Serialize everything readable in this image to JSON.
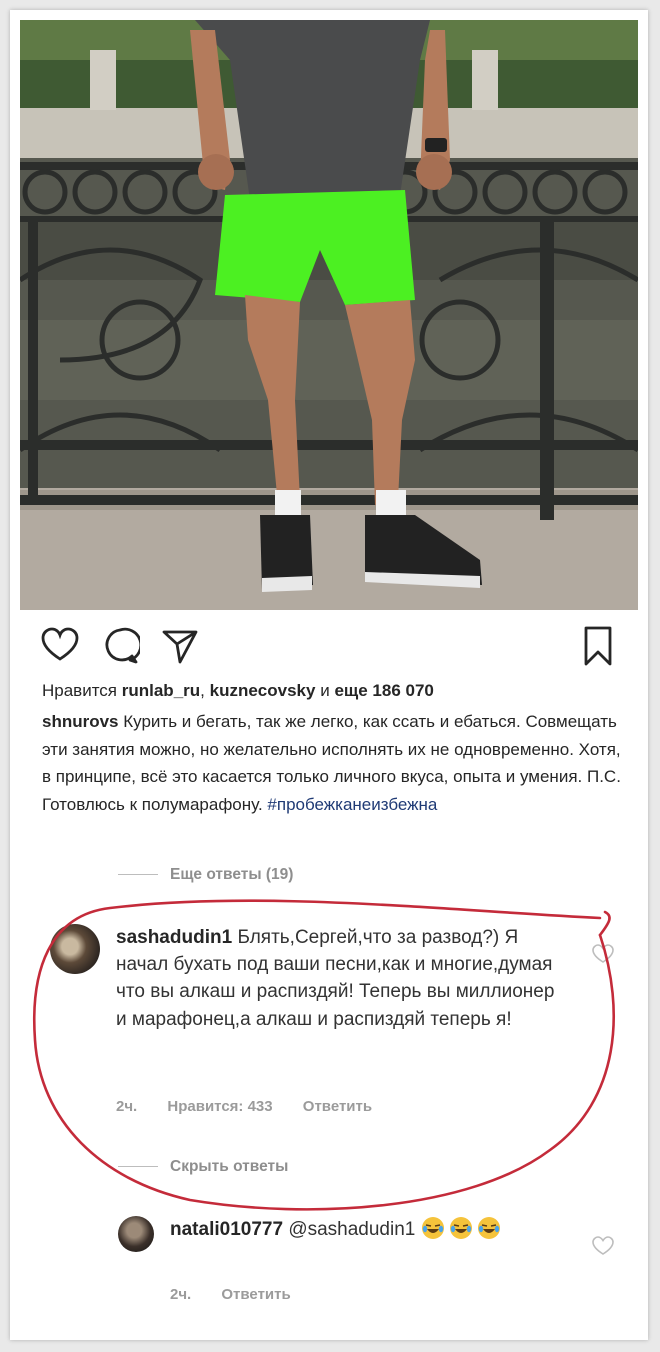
{
  "post": {
    "likes": {
      "prefix": "Нравится",
      "user1": "runlab_ru",
      "separator": ",",
      "user2": "kuznecovsky",
      "and": "и",
      "more": "еще 186 070"
    },
    "caption": {
      "username": "shnurovs",
      "text": "Курить и бегать, так же легко, как ссать и ебаться. Совмещать эти занятия можно, но желательно исполнять их не одновременно. Хотя, в принципе, всё это касается только личного вкуса, опыта и умения. П.С. Готовлюсь к полумарафону.",
      "hashtag": "#пробежканеизбежна"
    },
    "more_replies": "Еще ответы (19)"
  },
  "comment1": {
    "username": "sashadudin1",
    "text": "Блять,Сергей,что за развод?) Я начал бухать под ваши песни,как и многие,думая что вы алкаш и распиздяй! Теперь вы миллионер и марафонец,а алкаш и распиздяй теперь я!",
    "time": "2ч.",
    "likes": "Нравится: 433",
    "reply": "Ответить",
    "hide_replies": "Скрыть ответы"
  },
  "comment2": {
    "username": "natali010777",
    "mention": "@sashadudin1",
    "time": "2ч.",
    "reply": "Ответить"
  },
  "icons": {
    "like": "heart-icon",
    "comment": "comment-bubble-icon",
    "share": "paper-plane-icon",
    "save": "bookmark-icon",
    "emoji": "laughing-tears-emoji"
  },
  "colors": {
    "annotation": "#c42b3a",
    "hashtag": "#1f3a75",
    "shorts": "#4cf022"
  }
}
